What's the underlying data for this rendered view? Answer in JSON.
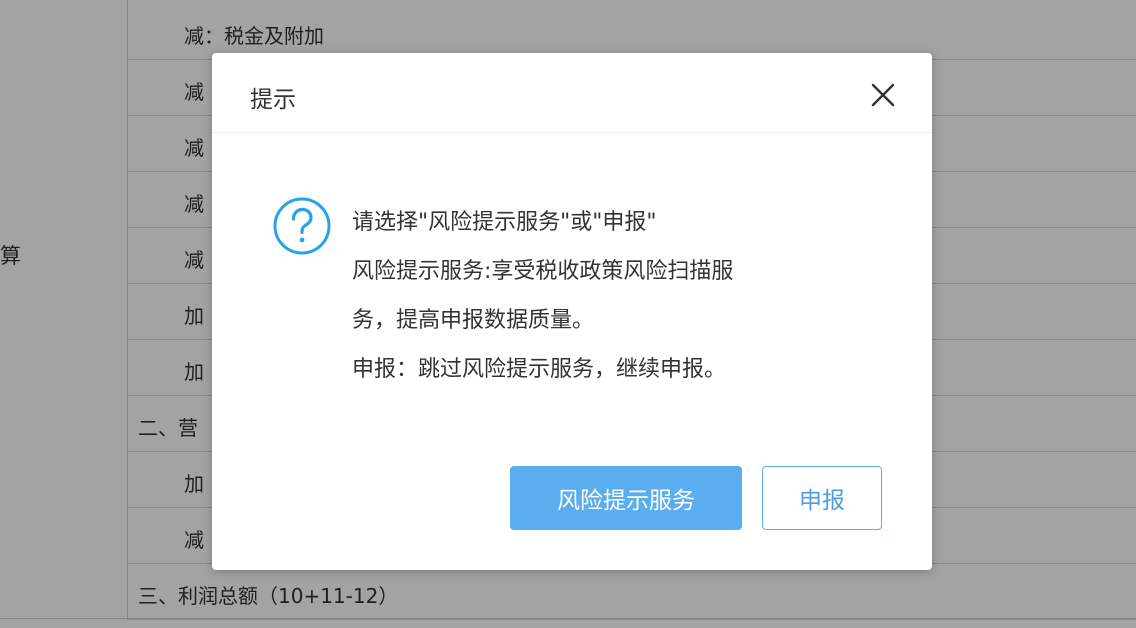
{
  "background": {
    "left_label": "算",
    "rows": [
      {
        "text": "减：税金及附加",
        "kind": "indent"
      },
      {
        "text": "减",
        "kind": "indent"
      },
      {
        "text": "减",
        "kind": "indent"
      },
      {
        "text": "减",
        "kind": "indent"
      },
      {
        "text": "减",
        "kind": "indent"
      },
      {
        "text": "加",
        "kind": "indent"
      },
      {
        "text": "加",
        "kind": "indent"
      },
      {
        "text": "二、营",
        "kind": "section"
      },
      {
        "text": "加",
        "kind": "indent"
      },
      {
        "text": "减",
        "kind": "indent"
      },
      {
        "text": "三、利润总额（10+11-12）",
        "kind": "section"
      }
    ]
  },
  "dialog": {
    "title": "提示",
    "close_icon": "close-icon",
    "question_icon": "question-circle-icon",
    "accent_color": "#26a3e6",
    "message_lines": [
      "请选择\"风险提示服务\"或\"申报\"",
      "风险提示服务:享受税收政策风险扫描服",
      "务，提高申报数据质量。",
      "申报：跳过风险提示服务，继续申报。"
    ],
    "primary_button": "风险提示服务",
    "secondary_button": "申报"
  }
}
